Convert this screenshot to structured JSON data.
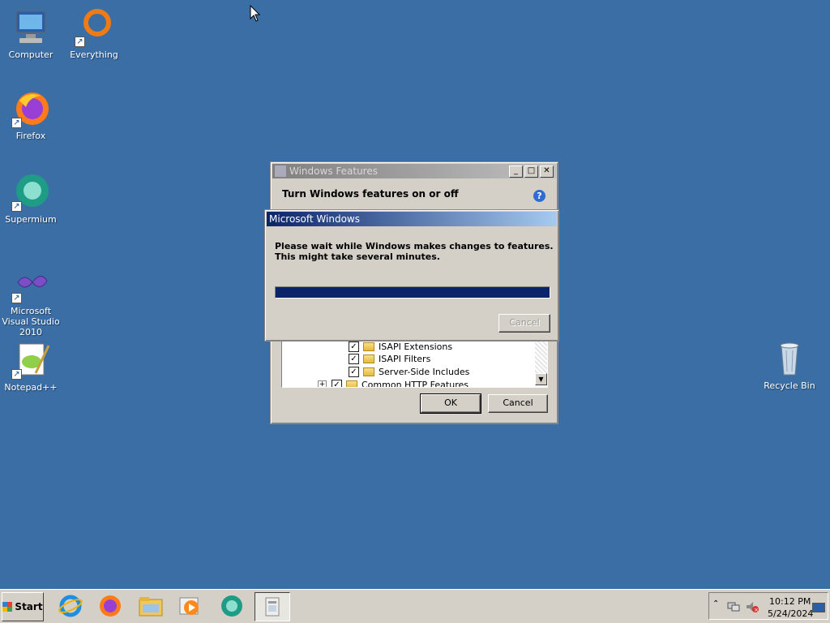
{
  "desktop": {
    "icons": [
      {
        "label": "Computer",
        "icon": "computer-icon"
      },
      {
        "label": "Everything",
        "icon": "everything-icon"
      },
      {
        "label": "Firefox",
        "icon": "firefox-icon"
      },
      {
        "label": "Supermium",
        "icon": "supermium-icon"
      },
      {
        "label": "Microsoft Visual Studio 2010",
        "icon": "visual-studio-icon"
      },
      {
        "label": "Notepad++",
        "icon": "notepad-plus-plus-icon"
      },
      {
        "label": "Recycle Bin",
        "icon": "recycle-bin-icon"
      }
    ]
  },
  "features_window": {
    "title": "Windows Features",
    "heading": "Turn Windows features on or off",
    "tree": [
      {
        "label": "ISAPI Extensions",
        "checked": true
      },
      {
        "label": "ISAPI Filters",
        "checked": true
      },
      {
        "label": "Server-Side Includes",
        "checked": true
      },
      {
        "label": "Common HTTP Features",
        "checked": true
      }
    ],
    "ok_label": "OK",
    "cancel_label": "Cancel"
  },
  "progress_dialog": {
    "title": "Microsoft Windows",
    "message": "Please wait while Windows makes changes to features. This might take several minutes.",
    "progress": 1.0,
    "cancel_label": "Cancel"
  },
  "taskbar": {
    "start_label": "Start",
    "apps": [
      "internet-explorer-icon",
      "firefox-icon",
      "file-explorer-icon",
      "media-player-icon",
      "supermium-icon",
      "windows-features-icon"
    ],
    "time": "10:12 PM",
    "date": "5/24/2024"
  },
  "colors": {
    "desktop": "#3a6ea5",
    "progress_fill": "#0a246a",
    "active_title": "#0a246a"
  }
}
